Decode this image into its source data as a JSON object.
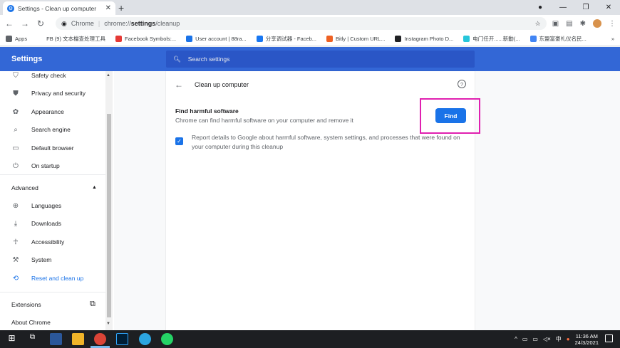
{
  "browser": {
    "tab_title": "Settings - Clean up computer",
    "omnibox_site": "Chrome",
    "url_scheme": "chrome://",
    "url_host": "settings",
    "url_path": "/cleanup",
    "bookmarks": [
      {
        "label": "Apps",
        "color": "#5f6368"
      },
      {
        "label": "FB (9) 文本檔查处理工具",
        "color": "#ffffff"
      },
      {
        "label": "Facebook Symbols:...",
        "color": "#e53935"
      },
      {
        "label": "User account | 88ra...",
        "color": "#1a73e8"
      },
      {
        "label": "分享调试器 - Faceb...",
        "color": "#1877f2"
      },
      {
        "label": "Bitly | Custom URL...",
        "color": "#ee6123"
      },
      {
        "label": "Instagram Photo D...",
        "color": "#202124"
      },
      {
        "label": "电门任开......新動(...",
        "color": "#26c6da"
      },
      {
        "label": "东盟富豪礼仪名民...",
        "color": "#4285f4"
      }
    ],
    "more_bookmarks": "»"
  },
  "settings": {
    "title": "Settings",
    "search_placeholder": "Search settings"
  },
  "sidebar": {
    "items": [
      {
        "label": "Safety check",
        "icon": "shield-check-icon"
      },
      {
        "label": "Privacy and security",
        "icon": "shield-icon"
      },
      {
        "label": "Appearance",
        "icon": "palette-icon"
      },
      {
        "label": "Search engine",
        "icon": "search-icon"
      },
      {
        "label": "Default browser",
        "icon": "browser-icon"
      },
      {
        "label": "On startup",
        "icon": "power-icon"
      }
    ],
    "advanced_label": "Advanced",
    "advanced_items": [
      {
        "label": "Languages",
        "icon": "globe-icon"
      },
      {
        "label": "Downloads",
        "icon": "download-icon"
      },
      {
        "label": "Accessibility",
        "icon": "accessibility-icon"
      },
      {
        "label": "System",
        "icon": "wrench-icon"
      },
      {
        "label": "Reset and clean up",
        "icon": "restore-icon"
      }
    ],
    "extensions_label": "Extensions",
    "about_label": "About Chrome"
  },
  "cleanup": {
    "page_title": "Clean up computer",
    "find_title": "Find harmful software",
    "find_description": "Chrome can find harmful software on your computer and remove it",
    "find_button": "Find",
    "report_checked": true,
    "report_text": "Report details to Google about harmful software, system settings, and processes that were found on your computer during this cleanup"
  },
  "taskbar": {
    "time": "11:36 AM",
    "date": "24/3/2021",
    "ime_label": "中"
  },
  "colors": {
    "accent": "#1a73e8",
    "header": "#3367d6",
    "highlight": "#e020b0"
  }
}
